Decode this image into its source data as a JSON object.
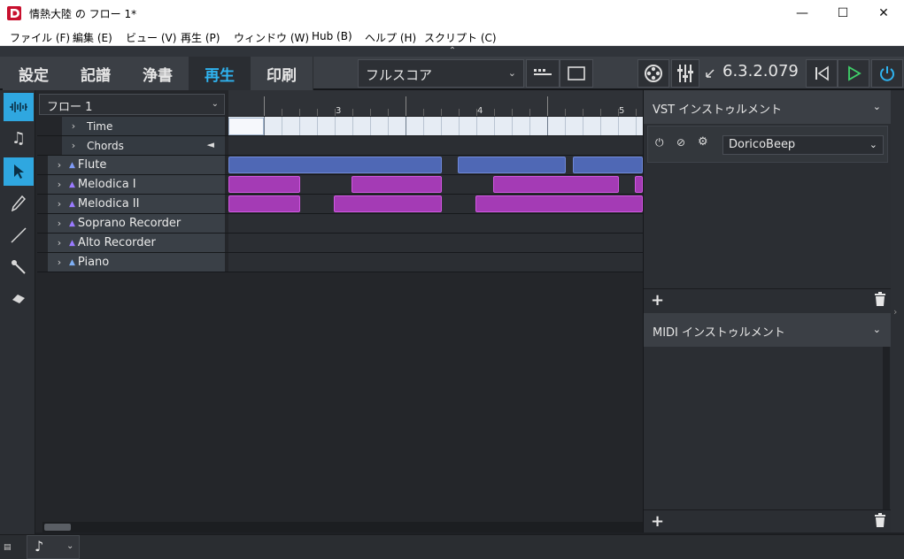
{
  "window": {
    "title": "情熱大陸 の フロー 1*"
  },
  "menu": [
    "ファイル (F)",
    "編集 (E)",
    "ビュー (V)",
    "再生 (P)",
    "ウィンドウ (W)",
    "Hub (B)",
    "ヘルプ (H)",
    "スクリプト (C)"
  ],
  "modes": [
    "設定",
    "記譜",
    "浄書",
    "再生",
    "印刷"
  ],
  "active_mode": "再生",
  "layout": {
    "selected": "フルスコア"
  },
  "version": "6.3.2.079",
  "flow": {
    "selected": "フロー 1"
  },
  "ruler": {
    "bars": [
      "3",
      "4",
      "5"
    ]
  },
  "tracks": [
    {
      "name": "Time",
      "type": "global"
    },
    {
      "name": "Chords",
      "type": "global"
    },
    {
      "name": "Flute",
      "type": "instrument"
    },
    {
      "name": "Melodica I",
      "type": "instrument"
    },
    {
      "name": "Melodica II",
      "type": "instrument"
    },
    {
      "name": "Soprano Recorder",
      "type": "instrument"
    },
    {
      "name": "Alto Recorder",
      "type": "instrument"
    },
    {
      "name": "Piano",
      "type": "instrument"
    }
  ],
  "panels": {
    "vst": {
      "title": "VST インストゥルメント",
      "instrument": "DoricoBeep"
    },
    "midi": {
      "title": "MIDI インストゥルメント"
    }
  },
  "colors": {
    "accent": "#2fb3f0",
    "flute": "#4f68b5",
    "melodica": "#a43bb5"
  }
}
